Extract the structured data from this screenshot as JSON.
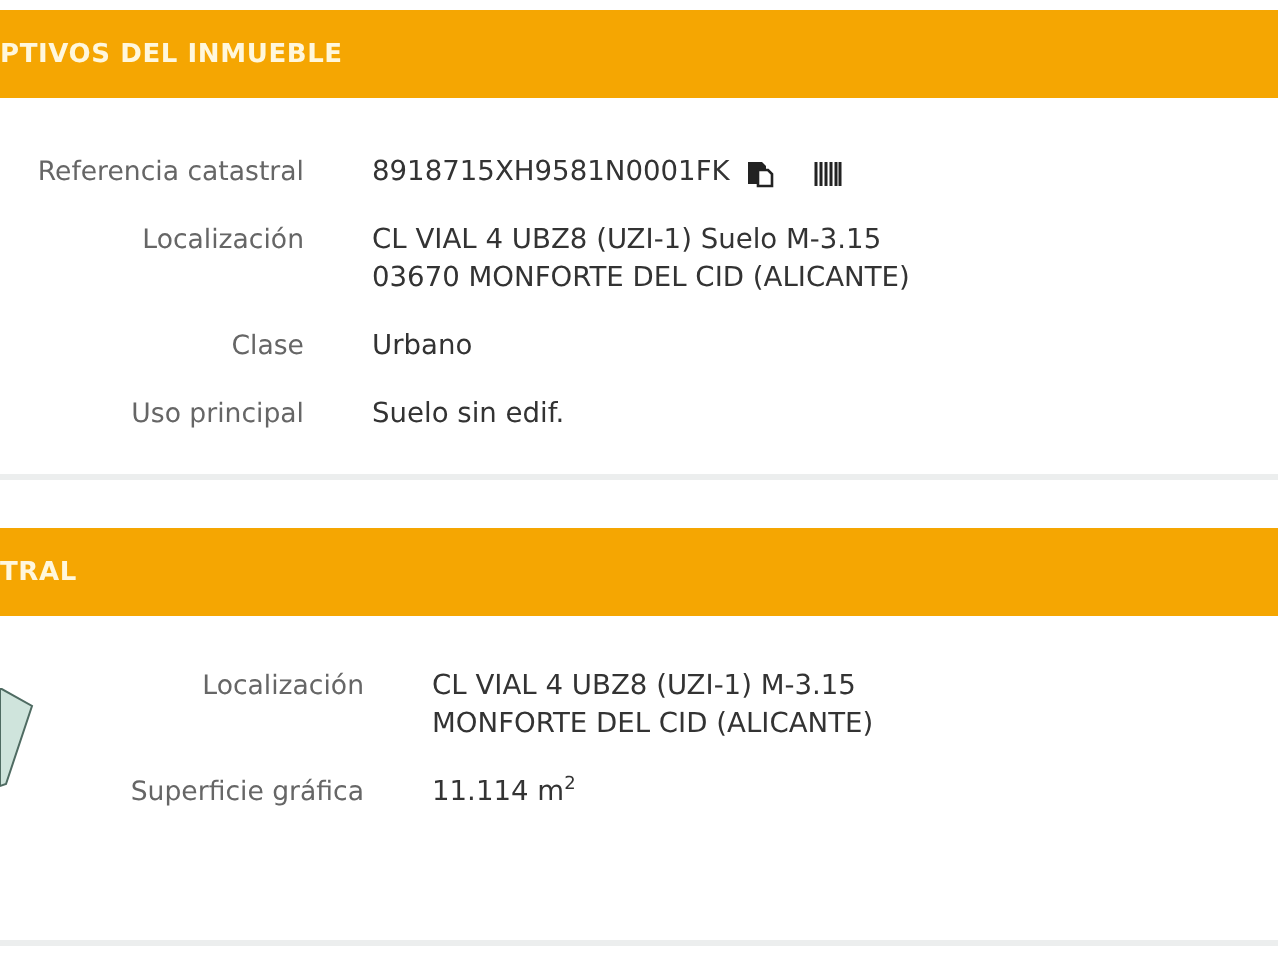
{
  "sections": [
    {
      "title": "PTIVOS DEL INMUEBLE",
      "kind": "details",
      "rows": [
        {
          "label": "Referencia catastral",
          "lines": [
            "8918715XH9581N0001FK"
          ],
          "kind": "reference"
        },
        {
          "label": "Localización",
          "lines": [
            "CL VIAL 4 UBZ8 (UZI-1) Suelo M-3.15",
            "03670 MONFORTE DEL CID (ALICANTE)"
          ],
          "kind": "text"
        },
        {
          "label": "Clase",
          "lines": [
            "Urbano"
          ],
          "kind": "text"
        },
        {
          "label": "Uso principal",
          "lines": [
            "Suelo sin edif."
          ],
          "kind": "text"
        }
      ]
    },
    {
      "title": "TRAL",
      "kind": "parcel",
      "rows": [
        {
          "label": "Localización",
          "lines": [
            "CL VIAL 4 UBZ8 (UZI-1) M-3.15",
            "MONFORTE DEL CID (ALICANTE)"
          ],
          "kind": "text"
        },
        {
          "label": "Superficie gráfica",
          "lines": [
            "11.114 m$^{2}$"
          ],
          "kind": "text"
        }
      ]
    }
  ]
}
